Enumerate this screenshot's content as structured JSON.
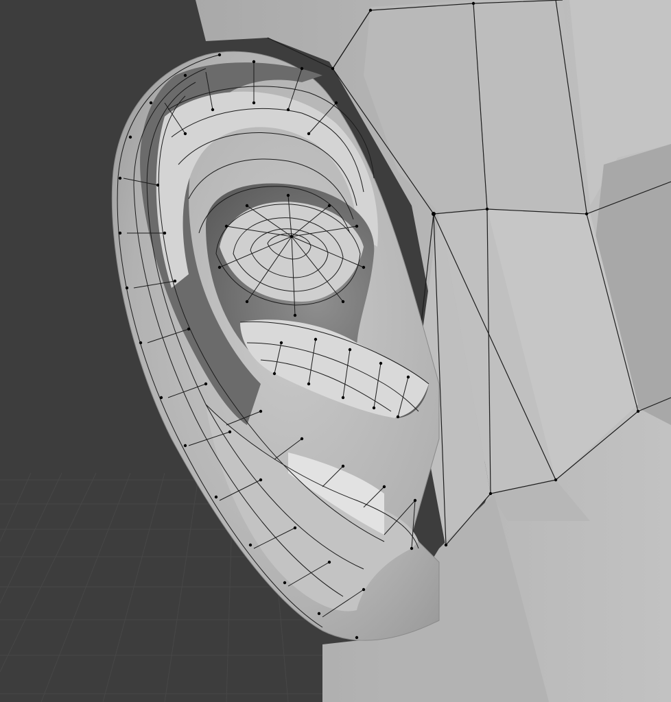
{
  "app": "3D viewport",
  "viewport": {
    "mode": "edit-mode-overlay",
    "shading": "solid",
    "background_color": "#3d3d3d",
    "grid_color": "#4a4a4a",
    "mesh_color": "#bdbdbd",
    "wire_color": "#1a1a1a",
    "vertex_color": "#000000"
  },
  "icons": [
    "grid-floor",
    "mesh-object",
    "wireframe-overlay",
    "vertex-dots"
  ]
}
